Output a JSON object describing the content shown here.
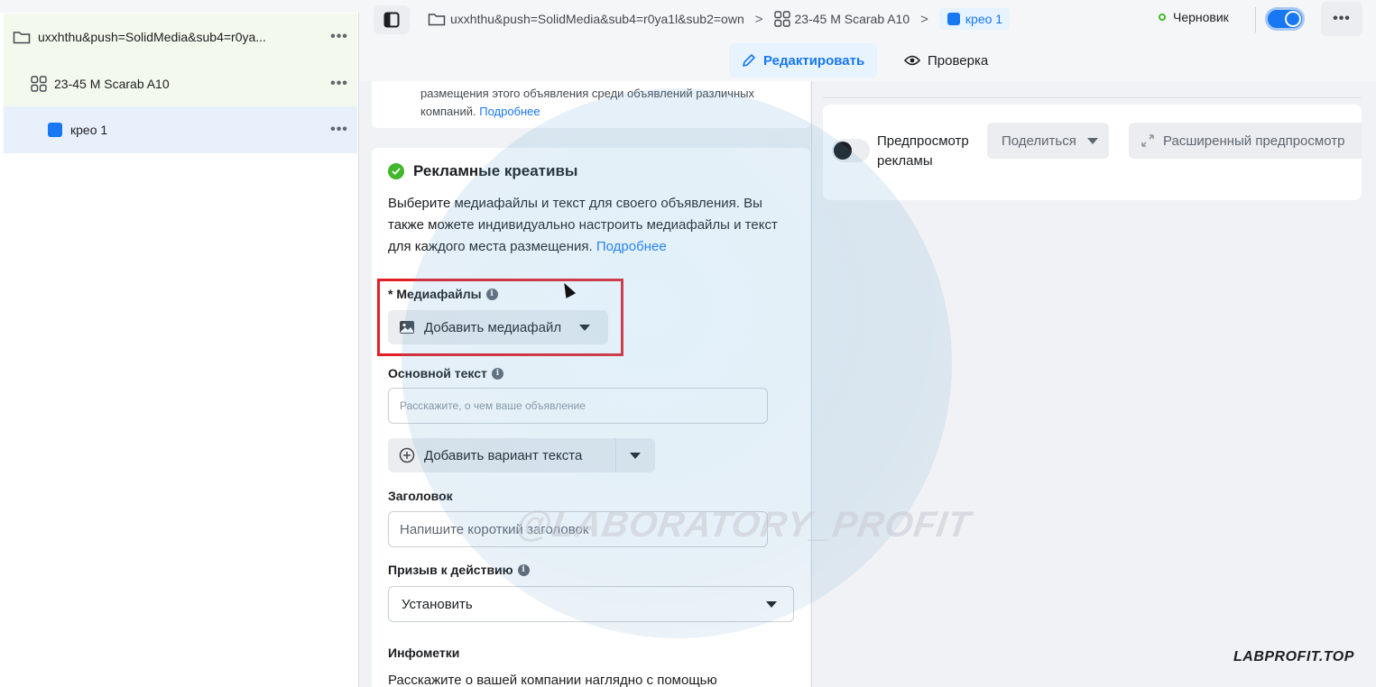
{
  "sidebar": {
    "campaign_label": "uxxhthu&push=SolidMedia&sub4=r0ya...",
    "adset_label": "23-45 M Scarab A10",
    "ad_label": "крео 1",
    "more_label": "•••"
  },
  "topbar": {
    "crumbs": [
      "uxxhthu&push=SolidMedia&sub4=r0ya1l&sub2=own",
      "23-45 M Scarab A10",
      "крео 1"
    ],
    "separator": ">",
    "status": "Черновик",
    "more_label": "•••"
  },
  "tabs": {
    "edit": "Редактировать",
    "review": "Проверка"
  },
  "editor": {
    "top_card_text": "размещения этого объявления среди объявлений различных компаний.",
    "more_link": "Подробнее",
    "section_title": "Рекламные креативы",
    "section_desc": "Выберите медиафайлы и текст для своего объявления. Вы также можете индивидуально настроить медиафайлы и текст для каждого места размещения.",
    "media_label": "* Медиафайлы",
    "add_media": "Добавить медиафайл",
    "primary_text_label": "Основной текст",
    "primary_text_placeholder": "Расскажите, о чем ваше объявление",
    "add_text_variant": "Добавить вариант текста",
    "headline_label": "Заголовок",
    "headline_placeholder": "Напишите короткий заголовок",
    "cta_label": "Призыв к действию",
    "cta_value": "Установить",
    "infotags_label": "Инфометки",
    "infotags_desc": "Расскажите о вашей компании наглядно с помощью"
  },
  "preview": {
    "toggle_label": "Предпросмотр рекламы",
    "share": "Поделиться",
    "advanced": "Расширенный предпросмотр"
  },
  "overlay": {
    "watermark": "@LABORATORY_PROFIT",
    "brand": "LABPROFIT.TOP"
  },
  "colors": {
    "accent": "#1877f2",
    "success": "#42b72a",
    "highlight": "#e41e26"
  }
}
